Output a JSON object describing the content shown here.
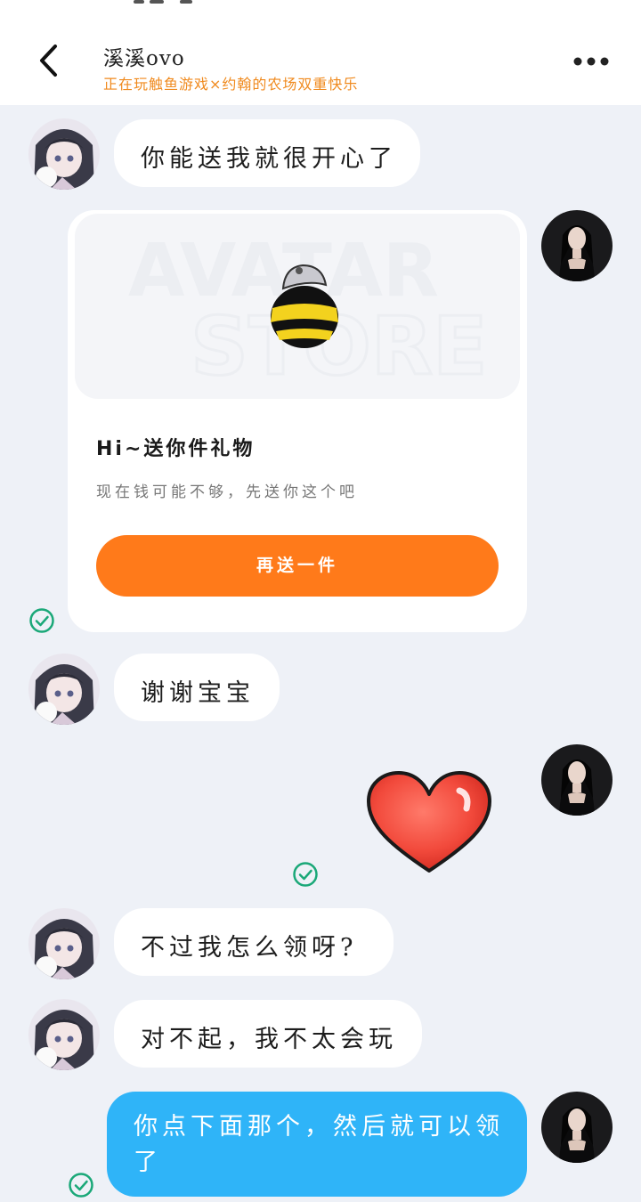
{
  "header": {
    "title": "溪溪ovo",
    "status": "正在玩触鱼游戏×约翰的农场双重快乐",
    "back_icon": "chevron-left-icon",
    "more_icon": "more-horizontal-icon"
  },
  "messages": [
    {
      "side": "left",
      "type": "text",
      "text": "你能送我就很开心了"
    },
    {
      "side": "right",
      "type": "gift_card",
      "title": "Hi~送你件礼物",
      "subtitle": "现在钱可能不够，先送你这个吧",
      "button": "再送一件",
      "watermark": "AVATAR STORE"
    },
    {
      "side": "left",
      "type": "text",
      "text": "谢谢宝宝"
    },
    {
      "side": "right",
      "type": "sticker",
      "sticker": "heart-sticker"
    },
    {
      "side": "left",
      "type": "text",
      "text": "不过我怎么领呀?"
    },
    {
      "side": "left",
      "type": "text",
      "text": "对不起，我不太会玩"
    },
    {
      "side": "right",
      "type": "text",
      "text": "你点下面那个，然后就可以领了"
    }
  ],
  "colors": {
    "accent_orange": "#ff7a1a",
    "status_orange": "#f08a1e",
    "bubble_blue": "#2fb4f8",
    "read_check_green": "#1aa878",
    "background": "#eef1f7"
  }
}
